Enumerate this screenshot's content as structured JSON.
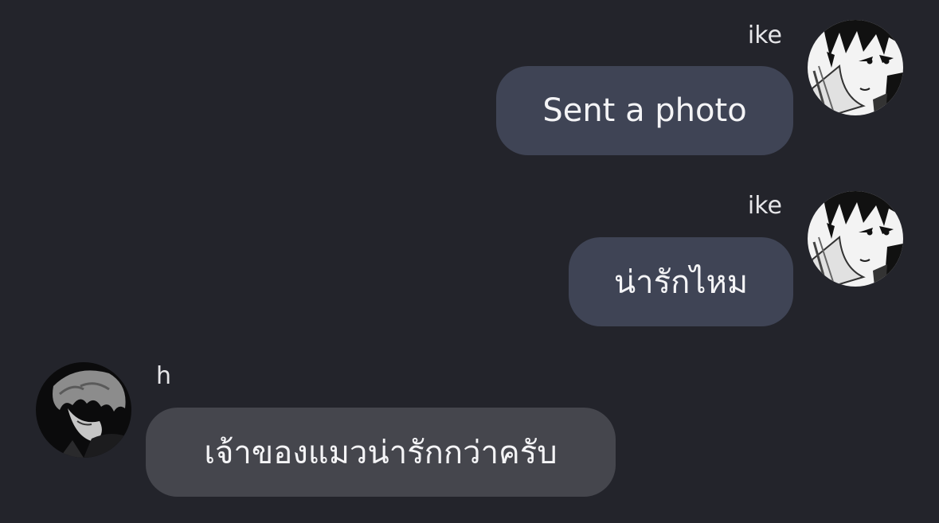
{
  "messages": [
    {
      "sender": "ike",
      "text": "Sent a photo",
      "avatar_icon": "manga-boy-avatar-icon"
    },
    {
      "sender": "ike",
      "text": "น่ารักไหม",
      "avatar_icon": "manga-boy-avatar-icon"
    },
    {
      "sender": "h",
      "text": "เจ้าของแมวน่ารักกว่าครับ",
      "avatar_icon": "dark-hair-boy-avatar-icon"
    }
  ],
  "colors": {
    "background": "#23242b",
    "outgoing_bubble": "#3f4455",
    "incoming_bubble": "#45464d",
    "text": "#f4f4f6"
  }
}
